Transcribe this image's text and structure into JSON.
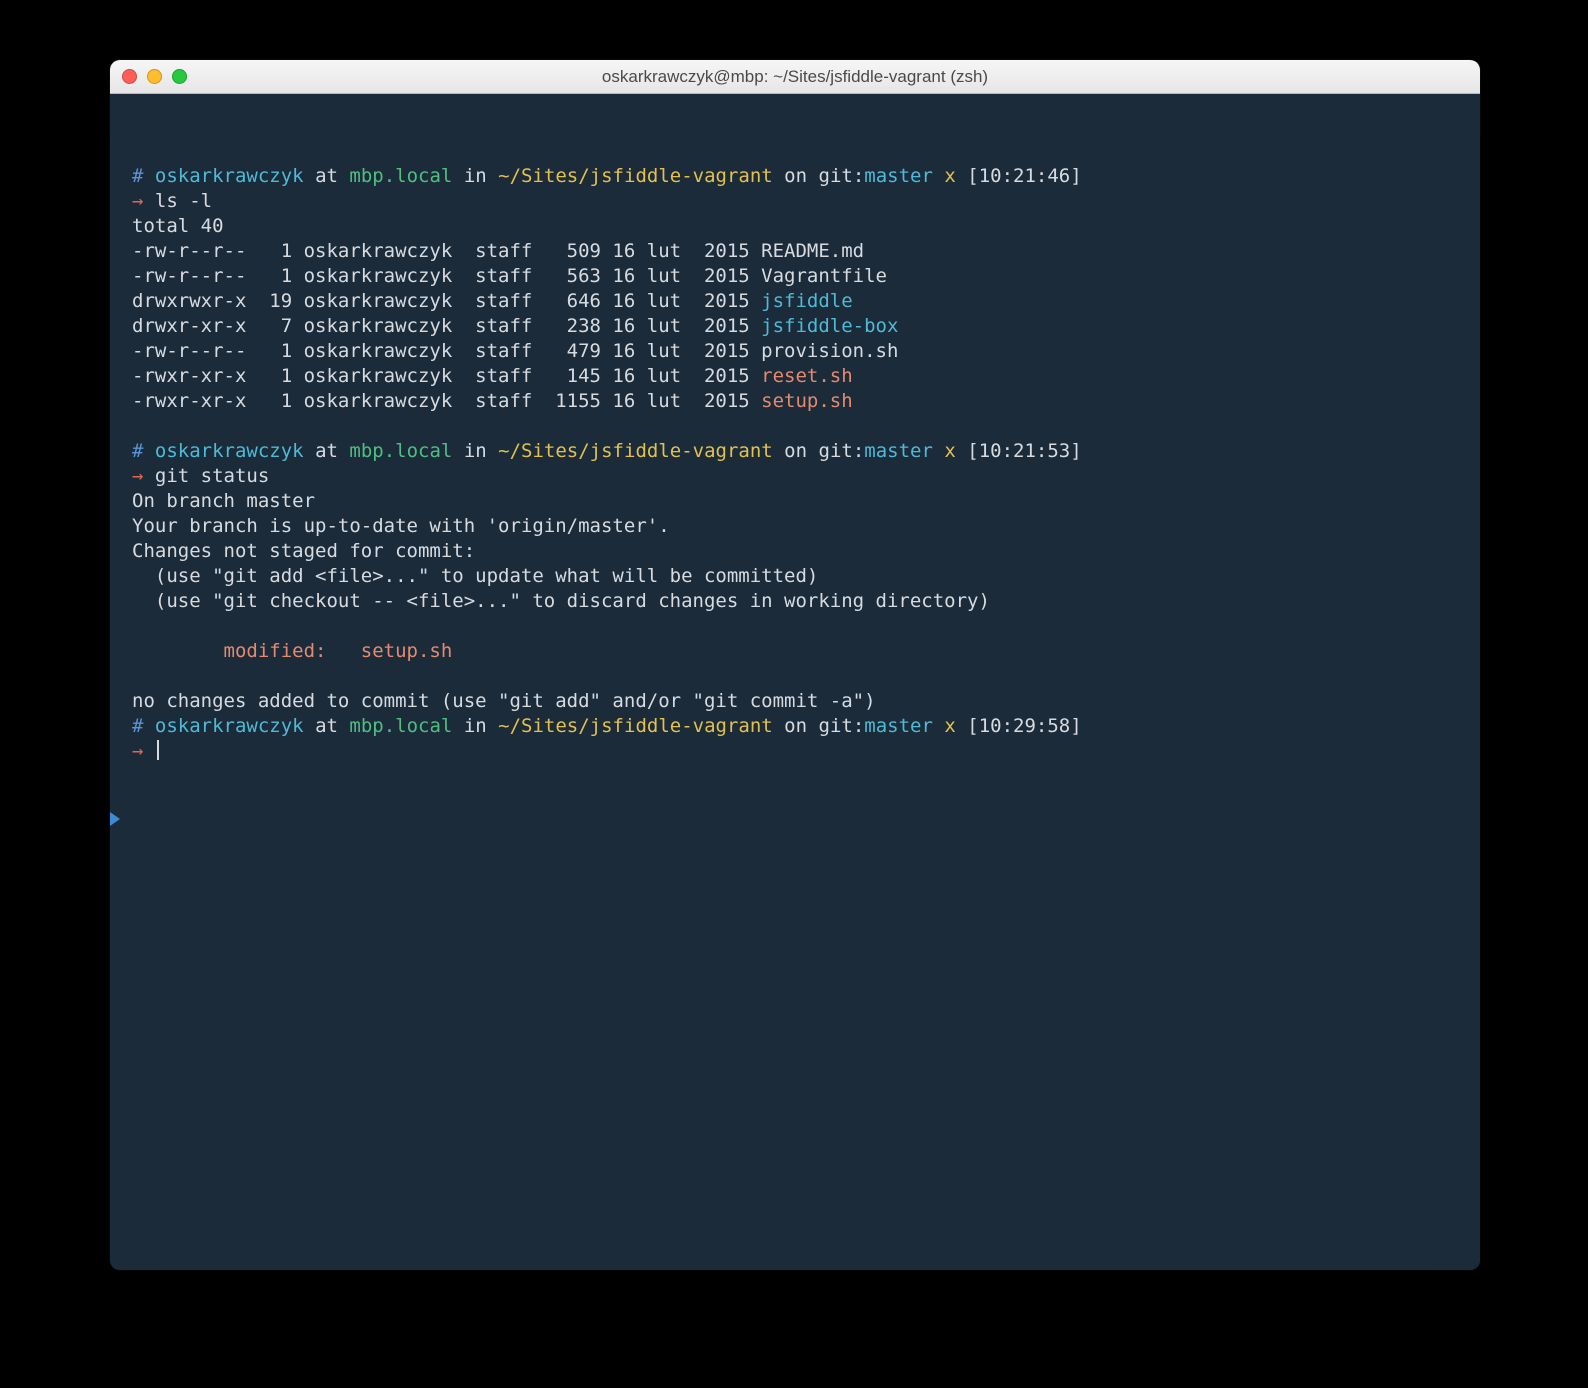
{
  "window": {
    "title": "oskarkrawczyk@mbp: ~/Sites/jsfiddle-vagrant (zsh)"
  },
  "prompt_tokens": {
    "hash": "#",
    "at": "at",
    "in": "in",
    "on": "on",
    "git_prefix": "git:",
    "dirty": "x",
    "arrow": "→"
  },
  "prompts": [
    {
      "user": "oskarkrawczyk",
      "host": "mbp.local",
      "path": "~/Sites/jsfiddle-vagrant",
      "branch": "master",
      "time": "[10:21:46]",
      "cmd": "ls -l"
    },
    {
      "user": "oskarkrawczyk",
      "host": "mbp.local",
      "path": "~/Sites/jsfiddle-vagrant",
      "branch": "master",
      "time": "[10:21:53]",
      "cmd": "git status"
    },
    {
      "user": "oskarkrawczyk",
      "host": "mbp.local",
      "path": "~/Sites/jsfiddle-vagrant",
      "branch": "master",
      "time": "[10:29:58]",
      "cmd": ""
    }
  ],
  "ls": {
    "total": "total 40",
    "rows": [
      {
        "perm": "-rw-r--r--",
        "links": "1",
        "owner": "oskarkrawczyk",
        "group": "staff",
        "size": "509",
        "date": "16 lut  2015",
        "name": "README.md",
        "kind": "plain"
      },
      {
        "perm": "-rw-r--r--",
        "links": "1",
        "owner": "oskarkrawczyk",
        "group": "staff",
        "size": "563",
        "date": "16 lut  2015",
        "name": "Vagrantfile",
        "kind": "plain"
      },
      {
        "perm": "drwxrwxr-x",
        "links": "19",
        "owner": "oskarkrawczyk",
        "group": "staff",
        "size": "646",
        "date": "16 lut  2015",
        "name": "jsfiddle",
        "kind": "dir"
      },
      {
        "perm": "drwxr-xr-x",
        "links": "7",
        "owner": "oskarkrawczyk",
        "group": "staff",
        "size": "238",
        "date": "16 lut  2015",
        "name": "jsfiddle-box",
        "kind": "dir"
      },
      {
        "perm": "-rw-r--r--",
        "links": "1",
        "owner": "oskarkrawczyk",
        "group": "staff",
        "size": "479",
        "date": "16 lut  2015",
        "name": "provision.sh",
        "kind": "plain"
      },
      {
        "perm": "-rwxr-xr-x",
        "links": "1",
        "owner": "oskarkrawczyk",
        "group": "staff",
        "size": "145",
        "date": "16 lut  2015",
        "name": "reset.sh",
        "kind": "exe"
      },
      {
        "perm": "-rwxr-xr-x",
        "links": "1",
        "owner": "oskarkrawczyk",
        "group": "staff",
        "size": "1155",
        "date": "16 lut  2015",
        "name": "setup.sh",
        "kind": "exe"
      }
    ]
  },
  "git_status": {
    "l1": "On branch master",
    "l2": "Your branch is up-to-date with 'origin/master'.",
    "l3": "Changes not staged for commit:",
    "l4": "  (use \"git add <file>...\" to update what will be committed)",
    "l5": "  (use \"git checkout -- <file>...\" to discard changes in working directory)",
    "mod_label": "modified:",
    "mod_file": "setup.sh",
    "l6": "no changes added to commit (use \"git add\" and/or \"git commit -a\")"
  }
}
